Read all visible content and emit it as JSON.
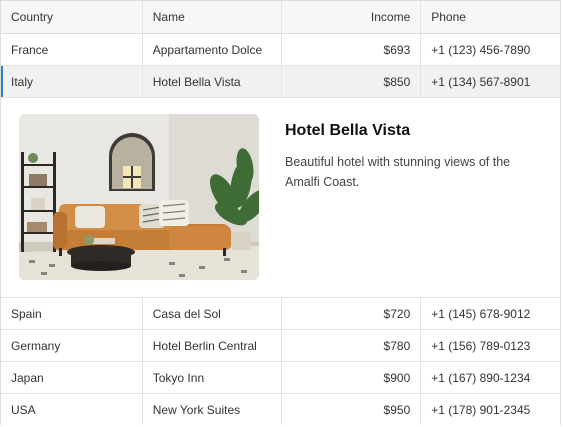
{
  "columns": {
    "country": "Country",
    "name": "Name",
    "income": "Income",
    "phone": "Phone"
  },
  "rows": [
    {
      "country": "France",
      "name": "Appartamento Dolce",
      "income": "$693",
      "phone": "+1 (123) 456-7890"
    },
    {
      "country": "Italy",
      "name": "Hotel Bella Vista",
      "income": "$850",
      "phone": "+1 (134) 567-8901"
    },
    {
      "country": "Spain",
      "name": "Casa del Sol",
      "income": "$720",
      "phone": "+1 (145) 678-9012"
    },
    {
      "country": "Germany",
      "name": "Hotel Berlin Central",
      "income": "$780",
      "phone": "+1 (156) 789-0123"
    },
    {
      "country": "Japan",
      "name": "Tokyo Inn",
      "income": "$900",
      "phone": "+1 (167) 890-1234"
    },
    {
      "country": "USA",
      "name": "New York Suites",
      "income": "$950",
      "phone": "+1 (178) 901-2345"
    }
  ],
  "detail": {
    "title": "Hotel Bella Vista",
    "description": "Beautiful hotel with stunning views of the Amalfi Coast.",
    "image": "living-room-photo"
  },
  "colors": {
    "selection_accent": "#2a7fd0",
    "header_bg": "#f7f7f7",
    "selected_row_bg": "#f1f1f1"
  }
}
